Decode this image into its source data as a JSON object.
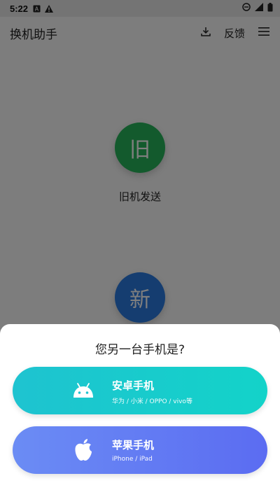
{
  "statusbar": {
    "time": "5:22"
  },
  "toolbar": {
    "title": "换机助手",
    "feedback": "反馈"
  },
  "main": {
    "old_phone": {
      "glyph": "旧",
      "label": "旧机发送"
    },
    "new_phone": {
      "glyph": "新"
    }
  },
  "sheet": {
    "question": "您另一台手机是?",
    "options": [
      {
        "title": "安卓手机",
        "subtitle": "华为 / 小米 / OPPO / vivo等",
        "icon": "android-icon"
      },
      {
        "title": "苹果手机",
        "subtitle": "iPhone / iPad",
        "icon": "apple-icon"
      }
    ]
  },
  "colors": {
    "old_green": "#27b45a",
    "new_blue": "#2a7be0",
    "android_teal": "#1ec3d0",
    "ios_blue": "#6b8cf4"
  }
}
